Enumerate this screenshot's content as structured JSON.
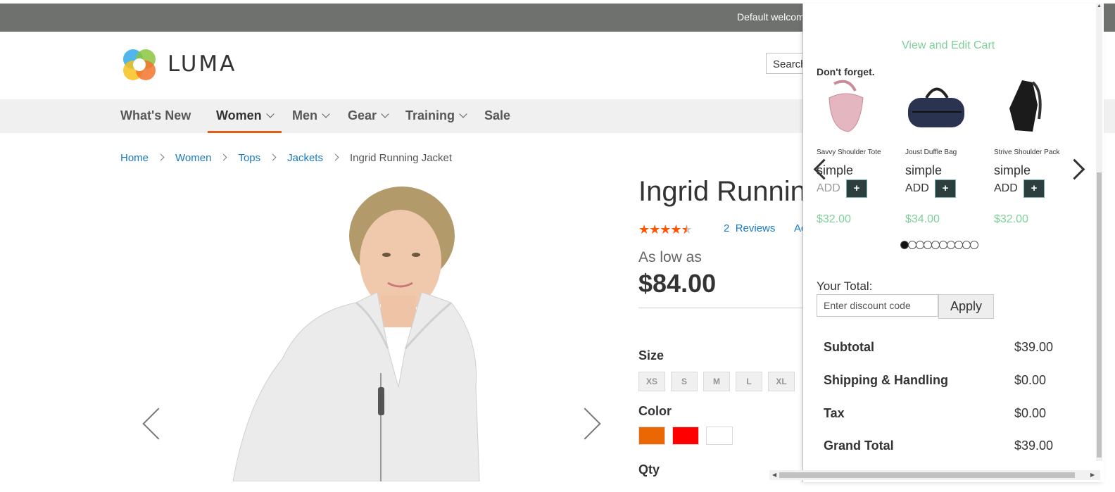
{
  "header": {
    "welcome": "Default welcome msg!",
    "logo_text": "LUMA",
    "search_placeholder": "Search entire store here..."
  },
  "nav": {
    "items": [
      {
        "label": "What's New"
      },
      {
        "label": "Women"
      },
      {
        "label": "Men"
      },
      {
        "label": "Gear"
      },
      {
        "label": "Training"
      },
      {
        "label": "Sale"
      }
    ]
  },
  "breadcrumb": {
    "items": [
      "Home",
      "Women",
      "Tops",
      "Jackets"
    ],
    "current": "Ingrid Running Jacket"
  },
  "product": {
    "title": "Ingrid Running Jacket",
    "rating": 4.5,
    "reviews_count": "2",
    "reviews_label": "Reviews",
    "add_review_label": "Add Your Review",
    "as_low_as": "As low as",
    "price": "$84.00",
    "size_label": "Size",
    "sizes": [
      "XS",
      "S",
      "M",
      "L",
      "XL"
    ],
    "color_label": "Color",
    "colors": [
      "#eb6703",
      "#ff0000",
      "#ffffff"
    ],
    "qty_label": "Qty"
  },
  "minicart": {
    "view_cart": "View and Edit Cart",
    "dont_forget": "Don't forget.",
    "related": [
      {
        "name": "Savvy Shoulder Tote",
        "type": "simple",
        "add": "ADD",
        "plus": "+",
        "price": "$32.00"
      },
      {
        "name": "Joust Duffle Bag",
        "type": "simple",
        "add": "ADD",
        "plus": "+",
        "price": "$34.00"
      },
      {
        "name": "Strive Shoulder Pack",
        "type": "simple",
        "add": "ADD",
        "plus": "+",
        "price": "$32.00"
      }
    ],
    "carousel_pages": 10,
    "carousel_active": 1,
    "your_total": "Your Total:",
    "discount_placeholder": "Enter discount code",
    "apply_label": "Apply",
    "totals": [
      {
        "label": "Subtotal",
        "value": "$39.00"
      },
      {
        "label": "Shipping & Handling",
        "value": "$0.00"
      },
      {
        "label": "Tax",
        "value": "$0.00"
      },
      {
        "label": "Grand Total",
        "value": "$39.00"
      }
    ]
  },
  "icons": {
    "nav_dropdown": "chevron-down-icon",
    "breadcrumb_sep": "chevron-right-icon",
    "gallery_prev": "chevron-left-icon",
    "gallery_next": "chevron-right-icon"
  }
}
